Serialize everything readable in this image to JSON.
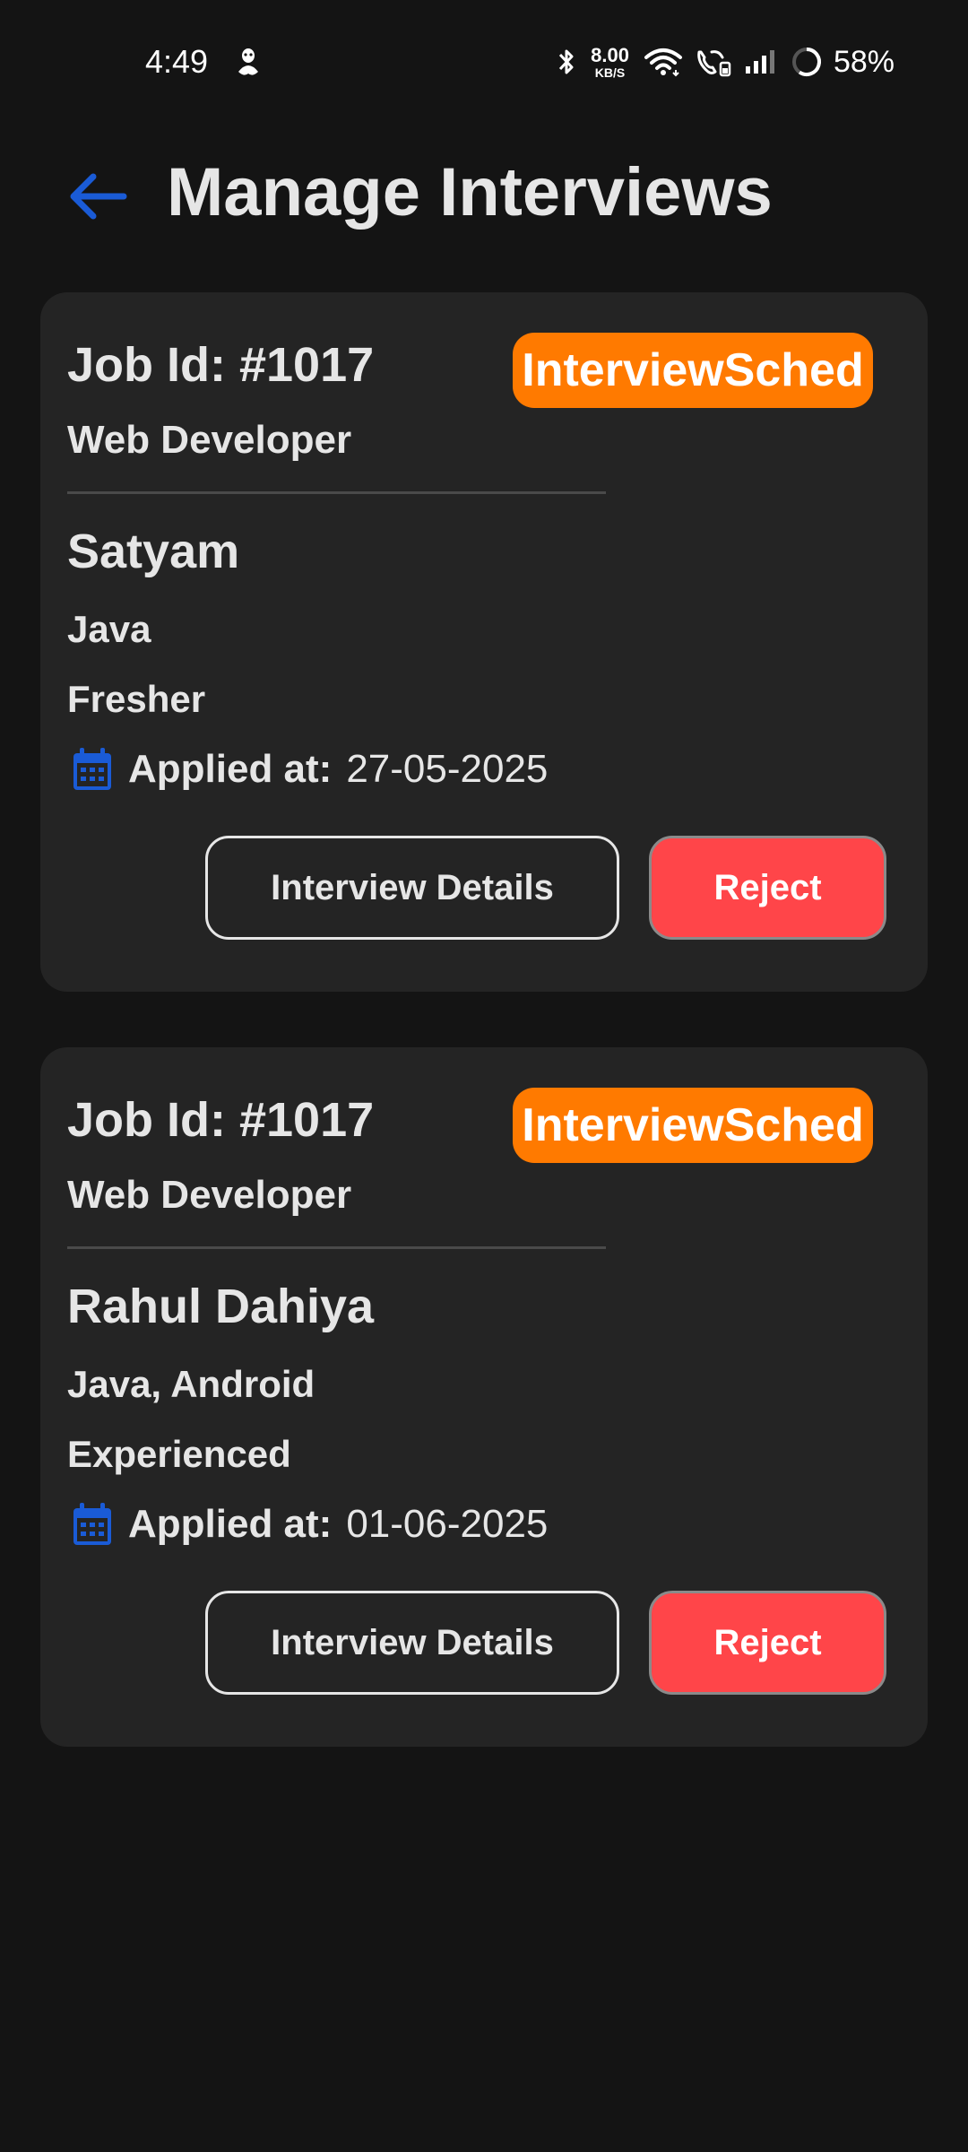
{
  "status_bar": {
    "time": "4:49",
    "net_speed_value": "8.00",
    "net_speed_unit": "KB/S",
    "battery_percent": "58%",
    "icons": [
      "notification-ghost-icon",
      "bluetooth-icon",
      "wifi-icon",
      "wifi-calling-icon",
      "signal-icon",
      "battery-ring-icon"
    ]
  },
  "header": {
    "back_icon": "arrow-left-icon",
    "title": "Manage Interviews"
  },
  "colors": {
    "background": "#141414",
    "card": "#242424",
    "accent_blue": "#1a5bd6",
    "badge_orange": "#ff7a00",
    "reject_red": "#ff4549",
    "text": "#e6e6e6"
  },
  "applications": [
    {
      "job_id": "Job Id: #1017",
      "status": "InterviewSched",
      "job_title": "Web Developer",
      "candidate_name": "Satyam",
      "skills": "Java",
      "experience": "Fresher",
      "applied_label": "Applied at:",
      "applied_date": "27-05-2025",
      "details_label": "Interview Details",
      "reject_label": "Reject"
    },
    {
      "job_id": "Job Id: #1017",
      "status": "InterviewSched",
      "job_title": "Web Developer",
      "candidate_name": "Rahul Dahiya",
      "skills": "Java, Android",
      "experience": "Experienced",
      "applied_label": "Applied at:",
      "applied_date": "01-06-2025",
      "details_label": "Interview Details",
      "reject_label": "Reject"
    }
  ]
}
